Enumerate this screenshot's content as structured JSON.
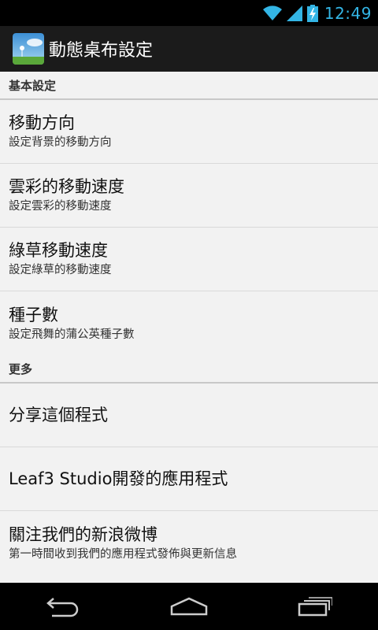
{
  "status_bar": {
    "time": "12:49",
    "icons": [
      "wifi-icon",
      "signal-icon",
      "battery-charging-icon"
    ],
    "accent": "#33b5e5"
  },
  "action_bar": {
    "title": "動態桌布設定",
    "icon": "app-icon"
  },
  "sections": {
    "basic": {
      "header": "基本設定",
      "items": [
        {
          "title": "移動方向",
          "summary": "設定背景的移動方向"
        },
        {
          "title": "雲彩的移動速度",
          "summary": "設定雲彩的移動速度"
        },
        {
          "title": "綠草移動速度",
          "summary": "設定綠草的移動速度"
        },
        {
          "title": "種子數",
          "summary": "設定飛舞的蒲公英種子數"
        }
      ]
    },
    "more": {
      "header": "更多",
      "items": [
        {
          "title": "分享這個程式"
        },
        {
          "title": "Leaf3 Studio開發的應用程式"
        },
        {
          "title": "關注我們的新浪微博",
          "summary": "第一時間收到我們的應用程式發佈與更新信息"
        }
      ]
    }
  },
  "nav_bar": {
    "buttons": [
      "back-icon",
      "home-icon",
      "recent-apps-icon"
    ]
  }
}
